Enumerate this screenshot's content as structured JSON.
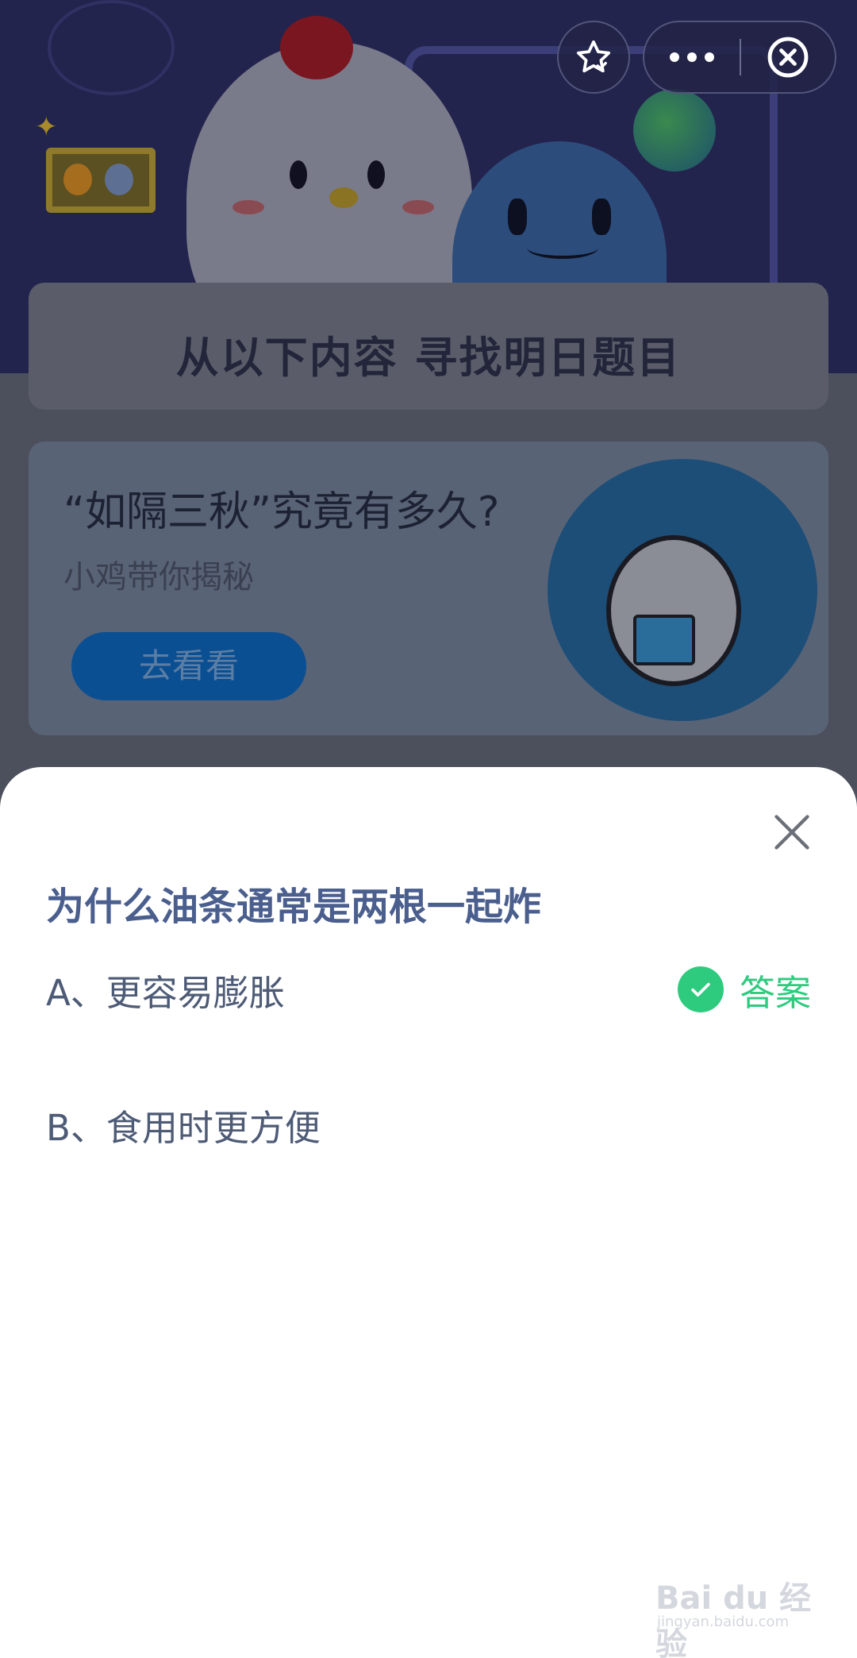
{
  "background": {
    "banner_title": "从以下内容  寻找明日题目",
    "promo": {
      "title": "“如隔三秋”究竟有多久?",
      "subtitle": "小鸡带你揭秘",
      "button_label": "去看看"
    }
  },
  "capsule": {
    "favorite_icon": "star-icon",
    "more_icon": "more-icon",
    "close_icon": "close-circle-icon"
  },
  "quiz": {
    "question": "为什么油条通常是两根一起炸",
    "options": [
      {
        "label": "A、更容易膨胀",
        "is_answer": true
      },
      {
        "label": "B、食用时更方便",
        "is_answer": false
      }
    ],
    "answer_label": "答案",
    "answer_color": "#2ecb7f",
    "question_color": "#4b5f8e"
  },
  "watermark": {
    "main": "Bai du 经验",
    "sub": "jingyan.baidu.com"
  }
}
